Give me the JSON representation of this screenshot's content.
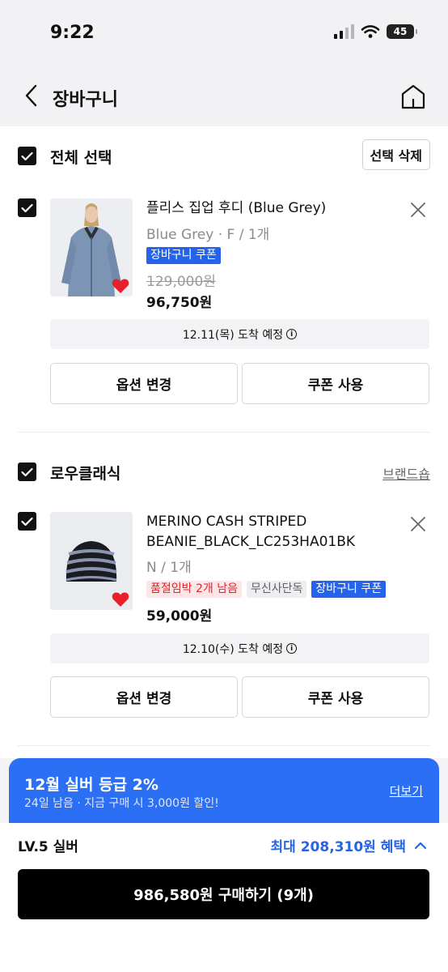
{
  "status_bar": {
    "time": "9:22",
    "battery": "45"
  },
  "nav": {
    "title": "장바구니"
  },
  "cart": {
    "select_all_label": "전체 선택",
    "delete_selected_label": "선택 삭제",
    "items": [
      {
        "name": "플리스 집업 후디 (Blue Grey)",
        "option": "Blue Grey · F / 1개",
        "badges": [
          "장바구니 쿠폰"
        ],
        "original_price": "129,000원",
        "price": "96,750원",
        "delivery": "12.11(목) 도착 예정",
        "option_button": "옵션 변경",
        "coupon_button": "쿠폰 사용"
      },
      {
        "brand": "로우클래식",
        "brand_link": "브랜드숍",
        "name_line1": "MERINO CASH STRIPED",
        "name_line2": "BEANIE_BLACK_LC253HA01BK",
        "option": "N / 1개",
        "badges": [
          "품절임박 2개 남음",
          "무신사단독",
          "장바구니 쿠폰"
        ],
        "price": "59,000원",
        "delivery": "12.10(수) 도착 예정",
        "option_button": "옵션 변경",
        "coupon_button": "쿠폰 사용"
      }
    ]
  },
  "promo": {
    "title": "12월 실버 등급 2%",
    "subtitle": "24일 남음 · 지금 구매 시 3,000원 할인!",
    "more_link": "더보기"
  },
  "footer": {
    "level": "LV.5 실버",
    "benefit": "최대 208,310원 혜택",
    "buy_button": "986,580원 구매하기 (9개)"
  },
  "colors": {
    "accent": "#2563eb",
    "promo_bg": "#2b6ff5",
    "soldout_red": "#e0242d",
    "heart": "#e8202a"
  }
}
